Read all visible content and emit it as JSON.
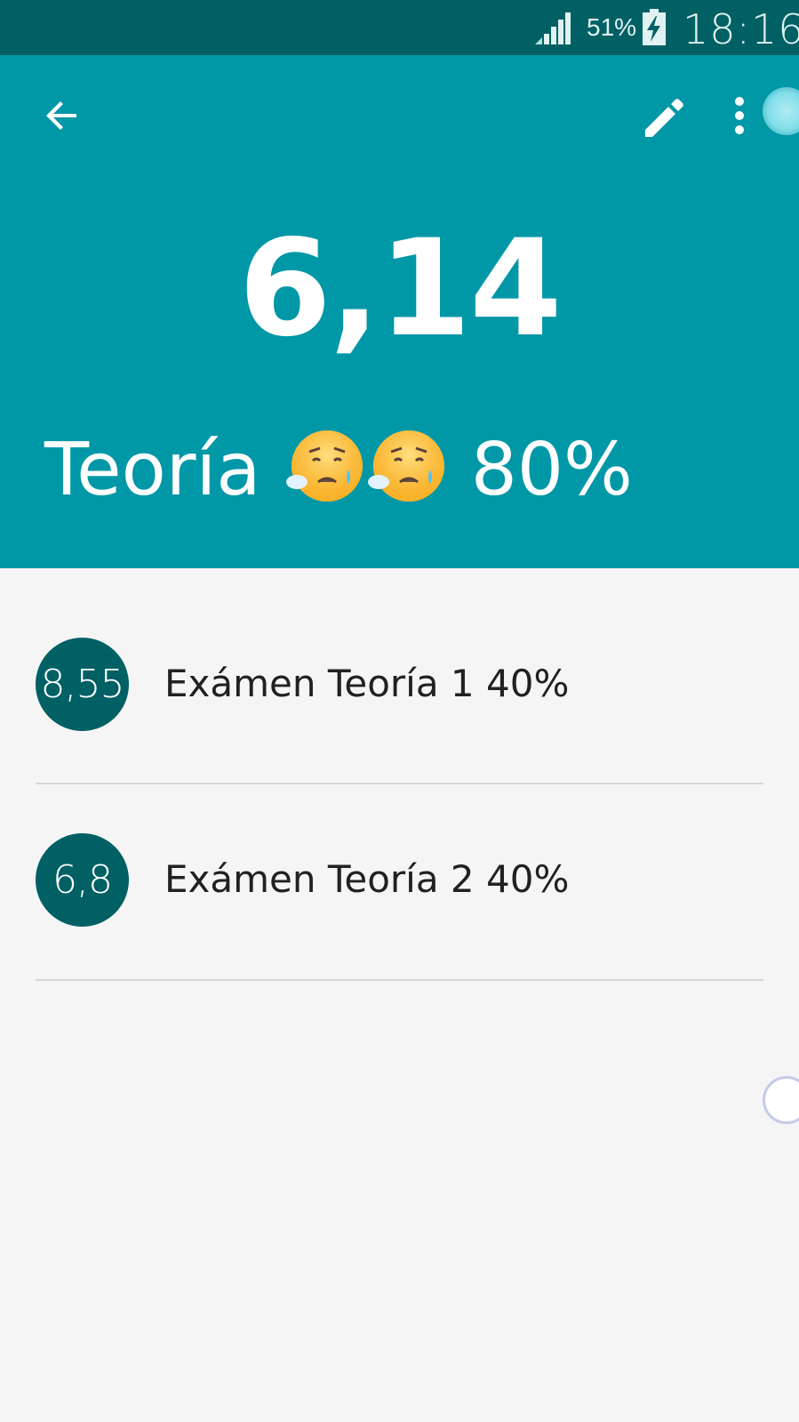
{
  "status_bar": {
    "battery_percent": "51%",
    "time": "18:16",
    "icons": [
      "signal-icon",
      "battery-charging-icon"
    ]
  },
  "toolbar": {
    "back_icon": "arrow-back-icon",
    "edit_icon": "pencil-icon",
    "more_icon": "more-vert-icon"
  },
  "summary": {
    "average": "6,14",
    "subject_name": "Teoría",
    "subject_emoji": "disappointed-relieved-emoji",
    "subject_weight": "80%"
  },
  "exams": [
    {
      "grade": "8,55",
      "label": "Exámen Teoría 1 40%"
    },
    {
      "grade": "6,8",
      "label": "Exámen Teoría 2 40%"
    }
  ],
  "colors": {
    "status_bar": "#006064",
    "header": "#0097a7",
    "grade_circle": "#006064",
    "background": "#f5f5f5",
    "divider": "#d6d6d6"
  }
}
